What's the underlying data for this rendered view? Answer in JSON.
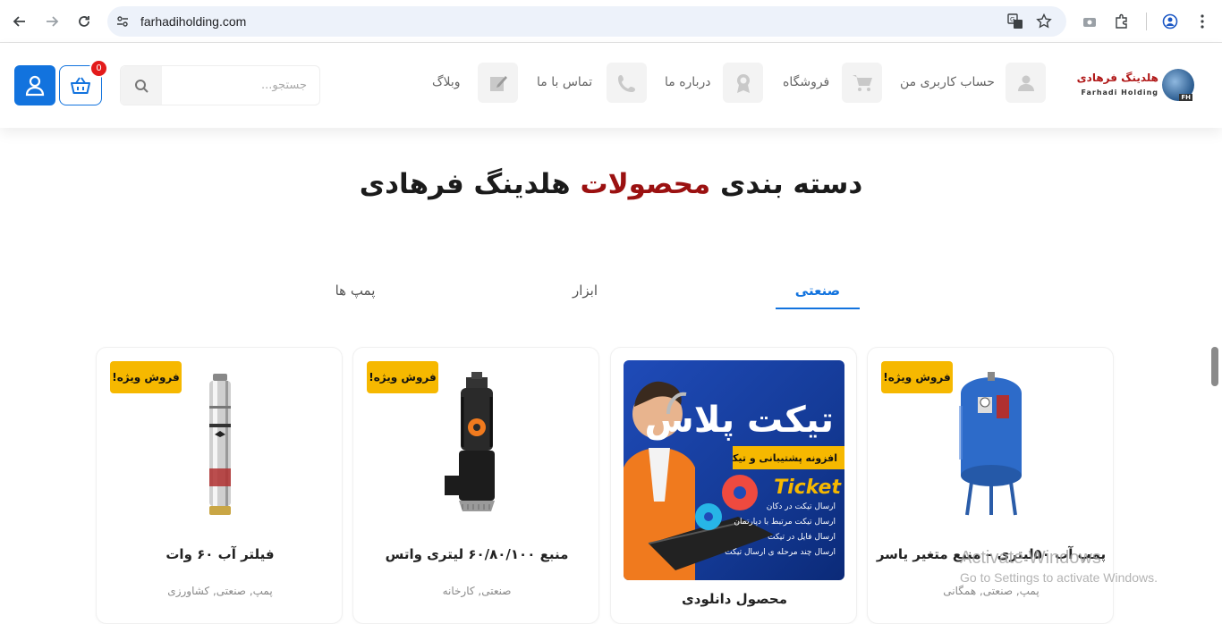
{
  "browser": {
    "url": "farhadiholding.com"
  },
  "site": {
    "logo": {
      "name_fa": "هلدینگ فرهادی",
      "name_en": "Farhadi Holding",
      "mark": "FH"
    },
    "nav": [
      {
        "label": "حساب کاربری من",
        "icon": "user-icon"
      },
      {
        "label": "فروشگاه",
        "icon": "cart-icon"
      },
      {
        "label": "درباره ما",
        "icon": "award-icon"
      },
      {
        "label": "تماس با ما",
        "icon": "phone-icon"
      },
      {
        "label": "وبلاگ",
        "icon": "edit-icon"
      }
    ],
    "search": {
      "placeholder": "جستجو..."
    },
    "cart": {
      "count": "0"
    },
    "accent_color": "#1273de"
  },
  "section": {
    "title_part1": "دسته بندی",
    "title_highlight": "محصولات",
    "title_part2": "هلدینگ فرهادی",
    "highlight_color": "#9b1111"
  },
  "tabs": [
    {
      "label": "صنعتی",
      "active": true
    },
    {
      "label": "ابزار",
      "active": false
    },
    {
      "label": "پمپ ها",
      "active": false
    }
  ],
  "products": [
    {
      "title": "پمپ آب ۵۰لیتری – منبع متغیر یاسر",
      "categories": "پمپ, صنعتی, همگانی",
      "badge": "فروش ویژه!"
    },
    {
      "title": "محصول دانلودی",
      "categories": "",
      "badge": "",
      "promo": {
        "title": "تیکت پلاس",
        "subtitle": "افزونه پشتیبانی و تیکتینگ",
        "en": "Ticket",
        "lines": [
          "ارسال تیکت در دکان",
          "ارسال تیکت مرتبط با دپارتمان",
          "ارسال فایل در تیکت",
          "ارسال چند مرحله ی ارسال تیکت"
        ]
      }
    },
    {
      "title": "منبع ۶۰/۸۰/۱۰۰ لیتری واتس",
      "categories": "صنعتی, کارخانه",
      "badge": "فروش ویژه!"
    },
    {
      "title": "فیلتر آب ۶۰ وات",
      "categories": "پمپ, صنعتی, کشاورزی",
      "badge": "فروش ویژه!"
    }
  ],
  "os_watermark": {
    "line1": "Activate Windows",
    "line2": "Go to Settings to activate Windows."
  }
}
